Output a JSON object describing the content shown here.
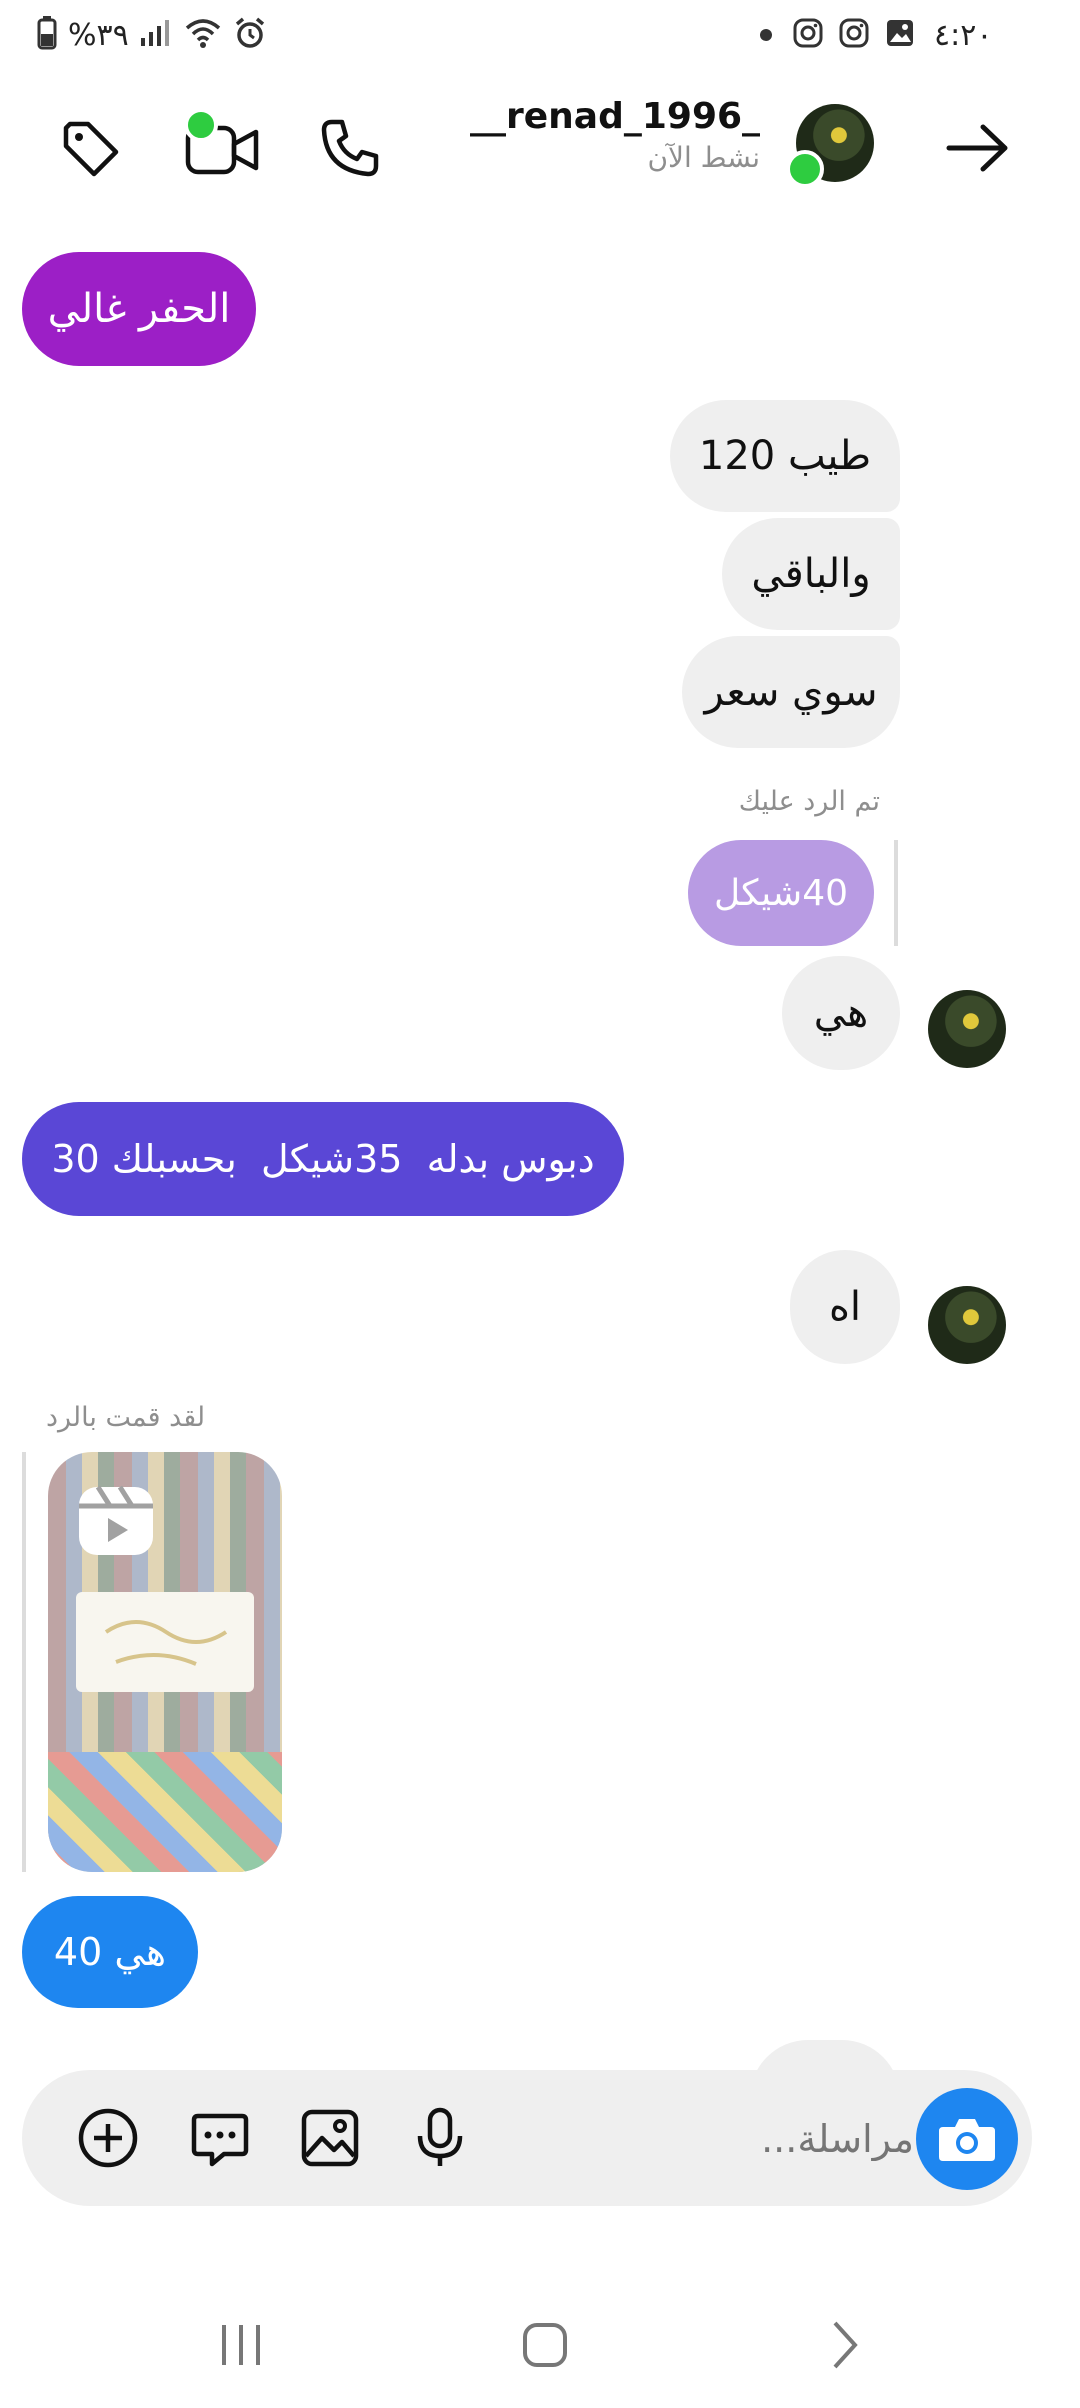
{
  "status": {
    "time": "٤:٢٠",
    "battery": "%٣٩"
  },
  "header": {
    "username": "__renad_1996_",
    "subtitle": "نشط الآن"
  },
  "messages": [
    {
      "side": "out",
      "text": "الحفر غالي",
      "color": "#9c1fc6"
    },
    {
      "side": "in",
      "text": "طيب 120"
    },
    {
      "side": "in",
      "text": "والباقي"
    },
    {
      "side": "in",
      "text": "سوي سعر"
    },
    {
      "side": "in",
      "reply_meta": "تم الرد عليك",
      "text": "40شيكل",
      "color": "#b89be3"
    },
    {
      "side": "in",
      "text": "هي"
    },
    {
      "side": "out",
      "text": "دبوس بدله  35شيكل  بحسبلك 30",
      "color": "#5a47d6"
    },
    {
      "side": "in",
      "text": "اه"
    },
    {
      "side": "out",
      "reply_meta": "لقد قمت بالرد",
      "media": "reel-thumbnail"
    },
    {
      "side": "out",
      "text": "هي 40",
      "color": "#1e86f0"
    }
  ],
  "composer": {
    "placeholder": "مراسلة..."
  },
  "colors": {
    "online": "#2ecc40",
    "camera_button": "#1e86f0",
    "input_bg": "#efefef"
  },
  "nav": {
    "recent": "recent-apps-icon",
    "home": "home-icon",
    "back": "back-icon"
  }
}
